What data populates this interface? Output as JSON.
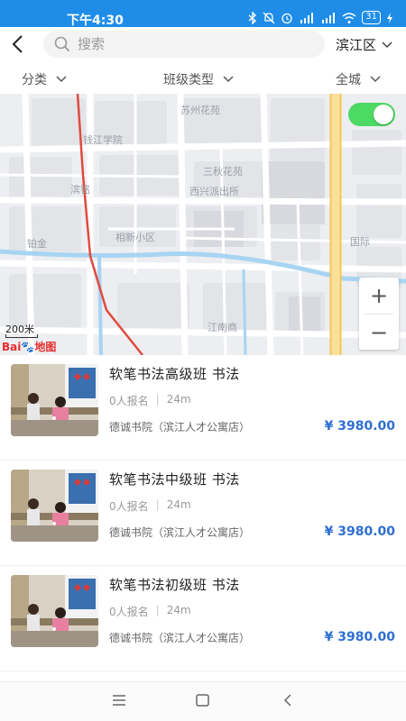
{
  "status_bar": {
    "time": "下午4:30",
    "battery": "31"
  },
  "header": {
    "search_placeholder": "搜索",
    "city": "滨江区"
  },
  "filters": [
    {
      "label": "分类"
    },
    {
      "label": "班级类型"
    },
    {
      "label": "全城"
    }
  ],
  "map": {
    "toggle_on": true,
    "scale_label": "200米",
    "logo_left": "Bai",
    "logo_right": "地图",
    "place_labels": [
      "苏州花苑",
      "钱江学院",
      "滨铭",
      "三秋花苑",
      "西兴派出所",
      "铂金",
      "相新小区",
      "国际",
      "江南商"
    ],
    "zoom_in": "+",
    "zoom_out": "−"
  },
  "courses": [
    {
      "title": "软笔书法高级班  书法",
      "enrolled": "0人报名",
      "distance": "24m",
      "school": "德诚书院（滨江人才公寓店）",
      "price": "¥ 3980.00"
    },
    {
      "title": "软笔书法中级班  书法",
      "enrolled": "0人报名",
      "distance": "24m",
      "school": "德诚书院（滨江人才公寓店）",
      "price": "¥ 3980.00"
    },
    {
      "title": "软笔书法初级班  书法",
      "enrolled": "0人报名",
      "distance": "24m",
      "school": "德诚书院（滨江人才公寓店）",
      "price": "¥ 3980.00"
    }
  ],
  "colors": {
    "status_bar": "#1f8de8",
    "price": "#2f6fd1",
    "toggle": "#4cd964",
    "main_road": "#f7d36b",
    "route": "#e04a3f",
    "river": "#a8d4f2"
  }
}
